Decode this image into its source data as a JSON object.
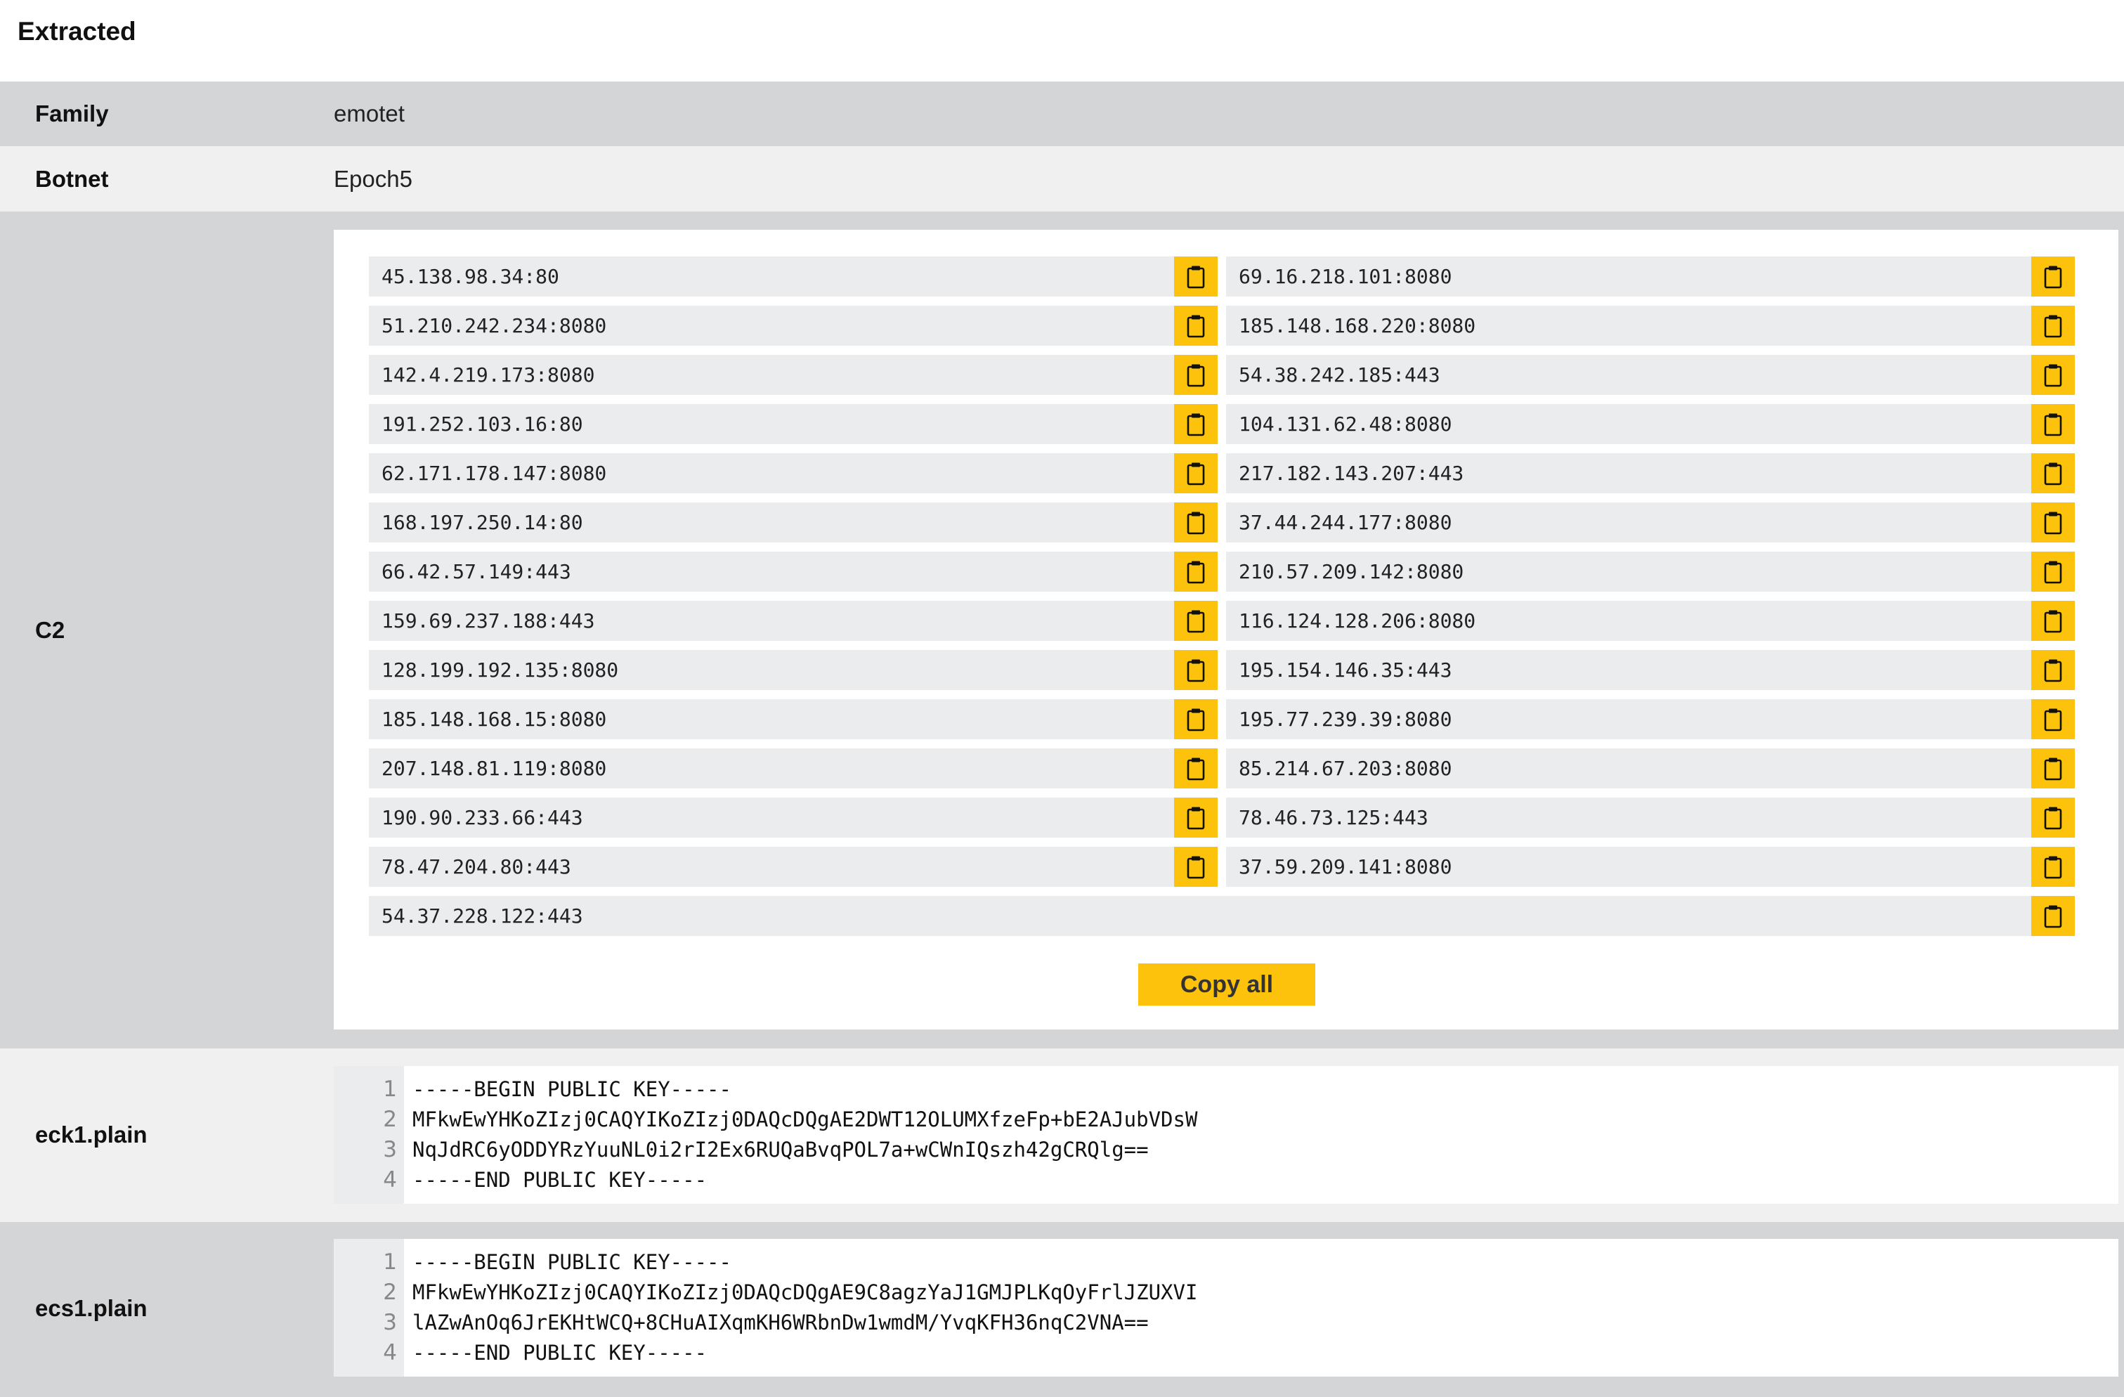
{
  "title": "Extracted",
  "family": {
    "label": "Family",
    "value": "emotet"
  },
  "botnet": {
    "label": "Botnet",
    "value": "Epoch5"
  },
  "c2": {
    "label": "C2",
    "copy_all_label": "Copy all",
    "button_color": "#fcc20c",
    "copy_icon": "clipboard-icon",
    "left_column": [
      "45.138.98.34:80",
      "51.210.242.234:8080",
      "142.4.219.173:8080",
      "191.252.103.16:80",
      "62.171.178.147:8080",
      "168.197.250.14:80",
      "66.42.57.149:443",
      "159.69.237.188:443",
      "128.199.192.135:8080",
      "185.148.168.15:8080",
      "207.148.81.119:8080",
      "190.90.233.66:443",
      "78.47.204.80:443"
    ],
    "right_column": [
      "69.16.218.101:8080",
      "185.148.168.220:8080",
      "54.38.242.185:443",
      "104.131.62.48:8080",
      "217.182.143.207:443",
      "37.44.244.177:8080",
      "210.57.209.142:8080",
      "116.124.128.206:8080",
      "195.154.146.35:443",
      "195.77.239.39:8080",
      "85.214.67.203:8080",
      "78.46.73.125:443",
      "37.59.209.141:8080"
    ],
    "last": "54.37.228.122:443"
  },
  "eck1": {
    "label": "eck1.plain",
    "lines": [
      {
        "n": "1",
        "text": "-----BEGIN PUBLIC KEY-----"
      },
      {
        "n": "2",
        "text": "MFkwEwYHKoZIzj0CAQYIKoZIzj0DAQcDQgAE2DWT12OLUMXfzeFp+bE2AJubVDsW"
      },
      {
        "n": "3",
        "text": "NqJdRC6yODDYRzYuuNL0i2rI2Ex6RUQaBvqPOL7a+wCWnIQszh42gCRQlg=="
      },
      {
        "n": "4",
        "text": "-----END PUBLIC KEY-----"
      }
    ]
  },
  "ecs1": {
    "label": "ecs1.plain",
    "lines": [
      {
        "n": "1",
        "text": "-----BEGIN PUBLIC KEY-----"
      },
      {
        "n": "2",
        "text": "MFkwEwYHKoZIzj0CAQYIKoZIzj0DAQcDQgAE9C8agzYaJ1GMJPLKqOyFrlJZUXVI"
      },
      {
        "n": "3",
        "text": "lAZwAnOq6JrEKHtWCQ+8CHuAIXqmKH6WRbnDw1wmdM/YvqKFH36nqC2VNA=="
      },
      {
        "n": "4",
        "text": "-----END PUBLIC KEY-----"
      }
    ]
  }
}
